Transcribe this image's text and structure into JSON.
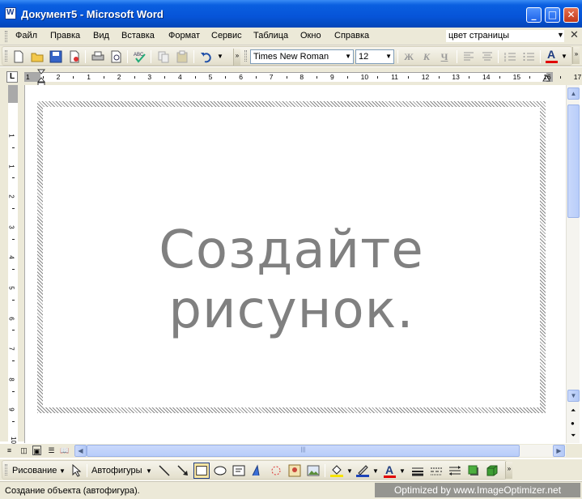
{
  "window": {
    "title": "Документ5 - Microsoft Word"
  },
  "menu": {
    "items": [
      "Файл",
      "Правка",
      "Вид",
      "Вставка",
      "Формат",
      "Сервис",
      "Таблица",
      "Окно",
      "Справка"
    ],
    "help_query": "цвет страницы"
  },
  "toolbar": {
    "font_name": "Times New Roman",
    "font_size": "12",
    "bold": "Ж",
    "italic": "К",
    "underline": "Ч",
    "font_color_letter": "A"
  },
  "ruler": {
    "tab_selector": "L",
    "numbers": [
      "1",
      "2",
      "1",
      "2",
      "3",
      "4",
      "5",
      "6",
      "7",
      "8",
      "9",
      "10",
      "11",
      "12",
      "13",
      "14",
      "15",
      "16",
      "17"
    ],
    "vertical_numbers": [
      "1",
      "1",
      "2",
      "3",
      "4",
      "5",
      "6",
      "7",
      "8",
      "9",
      "10"
    ]
  },
  "canvas": {
    "placeholder": "Создайте рисунок."
  },
  "drawing_toolbar": {
    "draw_menu": "Рисование",
    "autoshapes": "Автофигуры"
  },
  "status": {
    "text": "Создание объекта (автофигура)."
  },
  "watermark": "Optimized by www.ImageOptimizer.net",
  "colors": {
    "title_bar": "#0654d8",
    "chrome": "#ece9d8",
    "font_color_bar": "#e00000",
    "placeholder_text": "#808080"
  }
}
